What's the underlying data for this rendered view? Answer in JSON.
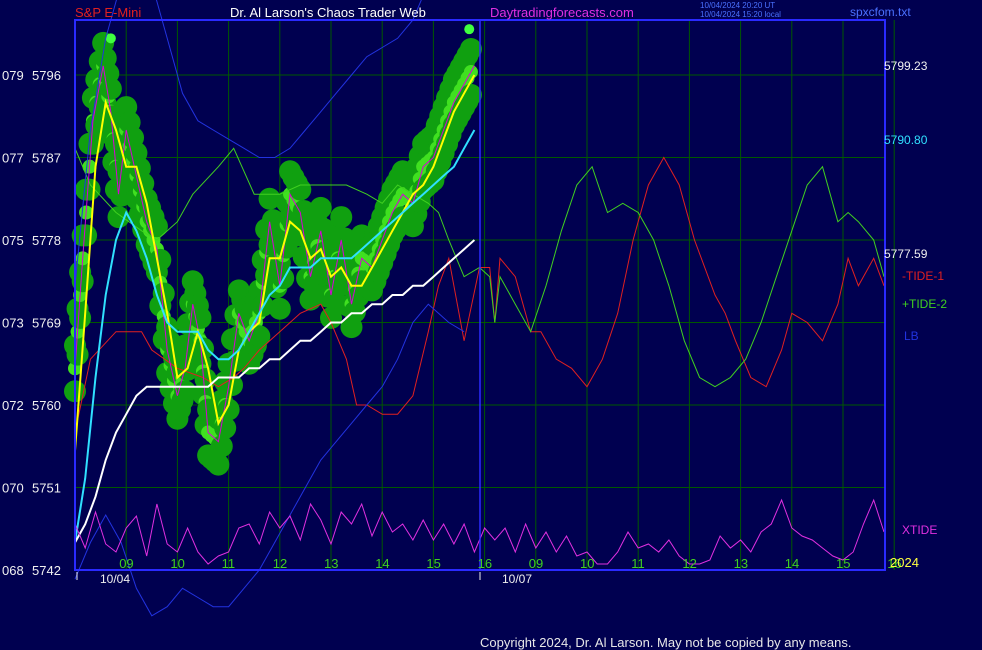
{
  "header": {
    "instrument": "S&P E-Mini",
    "site_title": "Dr. Al Larson's Chaos Trader Web",
    "url": "Daytradingforecasts.com",
    "timestamp_ut": "10/04/2024 20:20 UT",
    "timestamp_local": "10/04/2024 15:20 local",
    "file": "spxcfom.txt"
  },
  "footer": {
    "copyright": "Copyright 2024, Dr. Al Larson. May not be copied by any means."
  },
  "colors": {
    "background": "#000050",
    "frame": "#2a2aff",
    "grid": "#005800",
    "price": "#f0f0f0"
  },
  "chart_data": {
    "type": "line",
    "title": "S&P E-Mini",
    "ylim": [
      5742,
      5802
    ],
    "grid": true,
    "y_ticks": [
      {
        "left": "068",
        "price": "5742"
      },
      {
        "left": "070",
        "price": "5751"
      },
      {
        "left": "072",
        "price": "5760"
      },
      {
        "left": "073",
        "price": "5769"
      },
      {
        "left": "075",
        "price": "5778"
      },
      {
        "left": "077",
        "price": "5787"
      },
      {
        "left": "079",
        "price": "5796"
      }
    ],
    "x_hour_labels": [
      "09",
      "10",
      "11",
      "12",
      "13",
      "14",
      "15",
      "16",
      "09",
      "10",
      "11",
      "12",
      "13",
      "14",
      "15",
      "16"
    ],
    "date_labels": [
      "10/04",
      "10/07"
    ],
    "year_label": "2024",
    "right_labels": {
      "top_band": "5799.23",
      "middle_band": "5790.80",
      "close": "5777.59",
      "tide1": "-TIDE-1",
      "tide2": "+TIDE-2",
      "lb": "LB",
      "xtide": "XTIDE"
    },
    "series": [
      {
        "name": "-TIDE-1",
        "color": "#e02020",
        "x": [
          0,
          0.3,
          0.8,
          1.3,
          1.5,
          2.0,
          2.5,
          2.8,
          3.1,
          3.3,
          3.6,
          4.0,
          4.4,
          4.8,
          5.0,
          5.3,
          5.5,
          5.7,
          6.0,
          6.3,
          6.6,
          6.9,
          7.1,
          7.3,
          7.6,
          7.9,
          8.1,
          8.2,
          8.3,
          8.6,
          8.9,
          9.1,
          9.4,
          9.7,
          10.0,
          10.3,
          10.6,
          10.9,
          11.2,
          11.5,
          11.8,
          12.1,
          12.5,
          12.7,
          12.9,
          13.2,
          13.5,
          13.8,
          14.0,
          14.3,
          14.6,
          14.9,
          15.1,
          15.3,
          15.6,
          15.8
        ],
        "y": [
          5757,
          5765,
          5768,
          5768,
          5766,
          5764,
          5763,
          5762,
          5763,
          5764,
          5766,
          5768,
          5770,
          5771,
          5769,
          5765,
          5760,
          5760,
          5759,
          5759,
          5761,
          5768,
          5773,
          5776,
          5767,
          5775,
          5775,
          5769,
          5776,
          5774,
          5768,
          5768,
          5765,
          5764,
          5762,
          5765,
          5770,
          5778,
          5784,
          5787,
          5784,
          5778,
          5772,
          5770,
          5767,
          5763,
          5762,
          5766,
          5770,
          5769,
          5767,
          5771,
          5776,
          5773,
          5776,
          5773
        ]
      },
      {
        "name": "+TIDE-2",
        "color": "#40d020",
        "x": [
          0,
          0.3,
          0.8,
          1.3,
          1.6,
          2.0,
          2.3,
          2.8,
          3.1,
          3.5,
          4.0,
          4.4,
          4.8,
          5.0,
          5.3,
          5.7,
          6.0,
          6.3,
          6.6,
          6.9,
          7.1,
          7.3,
          7.6,
          7.9,
          8.1,
          8.2,
          8.3,
          8.6,
          8.9,
          9.2,
          9.5,
          9.8,
          10.1,
          10.4,
          10.7,
          11.0,
          11.3,
          11.6,
          11.9,
          12.2,
          12.5,
          12.8,
          13.1,
          13.4,
          13.7,
          14.0,
          14.3,
          14.6,
          14.9,
          15.1,
          15.3,
          15.6,
          15.8
        ],
        "y": [
          5788,
          5784,
          5781,
          5779,
          5778,
          5780,
          5783,
          5786,
          5788,
          5783,
          5783,
          5784,
          5784,
          5784,
          5784,
          5783,
          5782,
          5784,
          5783,
          5782,
          5781,
          5778,
          5774,
          5775,
          5774,
          5769,
          5774,
          5771,
          5768,
          5773,
          5779,
          5784,
          5786,
          5781,
          5782,
          5781,
          5778,
          5773,
          5767,
          5763,
          5762,
          5763,
          5765,
          5769,
          5774,
          5779,
          5784,
          5786,
          5780,
          5781,
          5780,
          5778,
          5774
        ]
      },
      {
        "name": "LB",
        "color": "#2233e0",
        "note": "upper band",
        "x": [
          0,
          0.3,
          0.6,
          0.9,
          1.2,
          1.5,
          1.8,
          2.1,
          2.4,
          2.7,
          3.0,
          3.3,
          3.6,
          3.9,
          4.2,
          4.5,
          4.8,
          5.1,
          5.4,
          5.7,
          6.0,
          6.3,
          6.6,
          6.9,
          7.1,
          7.3,
          7.6
        ],
        "y": [
          5773,
          5790,
          5800,
          5806,
          5808,
          5806,
          5800,
          5794,
          5791,
          5790,
          5789,
          5788,
          5787,
          5787,
          5788,
          5790,
          5792,
          5794,
          5796,
          5798,
          5799,
          5800,
          5802,
          5806,
          5810,
          5813,
          5814
        ]
      },
      {
        "name": "LB lower",
        "color": "#2233e0",
        "x": [
          0,
          0.3,
          0.6,
          0.9,
          1.2,
          1.5,
          1.8,
          2.1,
          2.4,
          2.7,
          3.0,
          3.3,
          3.6,
          3.9,
          4.2,
          4.5,
          4.8,
          5.1,
          5.4,
          5.7,
          6.0,
          6.3,
          6.6,
          6.9,
          7.1,
          7.3,
          7.6
        ],
        "y": [
          5741,
          5745,
          5748,
          5745,
          5740,
          5737,
          5738,
          5740,
          5739,
          5738,
          5738,
          5740,
          5742,
          5745,
          5748,
          5751,
          5754,
          5756,
          5758,
          5760,
          5762,
          5765,
          5769,
          5771,
          5770,
          5769,
          5768
        ]
      },
      {
        "name": "price",
        "color": "#d800d8",
        "x": [
          0,
          0.15,
          0.35,
          0.55,
          0.7,
          0.85,
          1.0,
          1.2,
          1.4,
          1.6,
          1.8,
          2.0,
          2.15,
          2.3,
          2.45,
          2.6,
          2.8,
          3.0,
          3.2,
          3.4,
          3.6,
          3.8,
          4.0,
          4.2,
          4.4,
          4.6,
          4.8,
          5.0,
          5.2,
          5.4,
          5.6,
          5.8,
          6.0,
          6.2,
          6.4,
          6.6,
          6.8,
          7.0,
          7.2,
          7.4,
          7.6,
          7.8
        ],
        "y": [
          5764,
          5776,
          5791,
          5797,
          5792,
          5783,
          5790,
          5785,
          5780,
          5777,
          5766,
          5761,
          5764,
          5771,
          5767,
          5757,
          5756,
          5762,
          5770,
          5767,
          5770,
          5780,
          5773,
          5783,
          5781,
          5774,
          5779,
          5772,
          5778,
          5771,
          5776,
          5775,
          5778,
          5781,
          5783,
          5782,
          5786,
          5787,
          5790,
          5793,
          5795,
          5797
        ]
      },
      {
        "name": "fast avg",
        "color": "#ffff00",
        "x": [
          0,
          0.2,
          0.4,
          0.6,
          0.8,
          1.0,
          1.2,
          1.4,
          1.6,
          1.8,
          2.0,
          2.2,
          2.4,
          2.6,
          2.8,
          3.0,
          3.2,
          3.4,
          3.6,
          3.8,
          4.0,
          4.2,
          4.4,
          4.6,
          4.8,
          5.0,
          5.2,
          5.4,
          5.6,
          5.8,
          6.0,
          6.2,
          6.4,
          6.6,
          6.8,
          7.0,
          7.2,
          7.4,
          7.6,
          7.8
        ],
        "y": [
          5755,
          5770,
          5786,
          5793,
          5790,
          5786,
          5786,
          5782,
          5776,
          5770,
          5763,
          5764,
          5768,
          5764,
          5758,
          5760,
          5766,
          5768,
          5769,
          5776,
          5776,
          5780,
          5779,
          5776,
          5777,
          5774,
          5775,
          5773,
          5773,
          5775,
          5777,
          5779,
          5781,
          5783,
          5784,
          5786,
          5789,
          5792,
          5794,
          5796
        ]
      },
      {
        "name": "medium avg",
        "color": "#30e0ff",
        "x": [
          0,
          0.2,
          0.4,
          0.6,
          0.8,
          1.0,
          1.2,
          1.4,
          1.6,
          1.8,
          2.0,
          2.2,
          2.4,
          2.6,
          2.8,
          3.0,
          3.2,
          3.4,
          3.6,
          3.8,
          4.0,
          4.2,
          4.4,
          4.6,
          4.8,
          5.0,
          5.2,
          5.4,
          5.6,
          5.8,
          6.0,
          6.2,
          6.4,
          6.6,
          6.8,
          7.0,
          7.2,
          7.4,
          7.6,
          7.8
        ],
        "y": [
          5745,
          5752,
          5763,
          5772,
          5778,
          5781,
          5779,
          5776,
          5772,
          5769,
          5768,
          5768,
          5768,
          5766,
          5765,
          5765,
          5766,
          5768,
          5770,
          5772,
          5773,
          5775,
          5775,
          5775,
          5776,
          5776,
          5776,
          5776,
          5777,
          5778,
          5779,
          5780,
          5781,
          5782,
          5783,
          5784,
          5785,
          5786,
          5788,
          5790
        ]
      },
      {
        "name": "slow avg",
        "color": "#ffffff",
        "x": [
          0,
          0.2,
          0.4,
          0.6,
          0.8,
          1.0,
          1.2,
          1.4,
          1.6,
          1.8,
          2.0,
          2.2,
          2.4,
          2.6,
          2.8,
          3.0,
          3.2,
          3.4,
          3.6,
          3.8,
          4.0,
          4.2,
          4.4,
          4.6,
          4.8,
          5.0,
          5.2,
          5.4,
          5.6,
          5.8,
          6.0,
          6.2,
          6.4,
          6.6,
          6.8,
          7.0,
          7.2,
          7.4,
          7.6,
          7.8
        ],
        "y": [
          5745,
          5747,
          5750,
          5754,
          5757,
          5759,
          5761,
          5762,
          5762,
          5762,
          5762,
          5762,
          5762,
          5762,
          5763,
          5763,
          5763,
          5764,
          5764,
          5765,
          5765,
          5766,
          5767,
          5767,
          5768,
          5769,
          5769,
          5770,
          5770,
          5771,
          5771,
          5772,
          5772,
          5773,
          5773,
          5774,
          5775,
          5776,
          5777,
          5778
        ]
      },
      {
        "name": "XTIDE",
        "color": "#e030e0",
        "x": [
          0,
          0.2,
          0.4,
          0.6,
          0.8,
          1.0,
          1.2,
          1.4,
          1.6,
          1.8,
          2.0,
          2.2,
          2.4,
          2.6,
          2.8,
          3.0,
          3.2,
          3.4,
          3.6,
          3.8,
          4.0,
          4.2,
          4.4,
          4.6,
          4.8,
          5.0,
          5.2,
          5.4,
          5.6,
          5.8,
          6.0,
          6.2,
          6.4,
          6.6,
          6.8,
          7.0,
          7.2,
          7.4,
          7.6,
          7.8,
          8.0,
          8.2,
          8.4,
          8.6,
          8.8,
          9.0,
          9.2,
          9.4,
          9.6,
          9.8,
          10.0,
          10.2,
          10.4,
          10.6,
          10.8,
          11.0,
          11.2,
          11.4,
          11.6,
          11.8,
          12.0,
          12.2,
          12.4,
          12.6,
          12.8,
          13.0,
          13.2,
          13.4,
          13.6,
          13.8,
          14.0,
          14.2,
          14.4,
          14.6,
          14.8,
          15.0,
          15.2,
          15.4,
          15.6,
          15.8
        ],
        "y": [
          0.55,
          0.25,
          0.7,
          0.3,
          0.2,
          0.5,
          0.65,
          0.15,
          0.8,
          0.3,
          0.2,
          0.5,
          0.2,
          0.05,
          0.15,
          0.2,
          0.5,
          0.55,
          0.3,
          0.7,
          0.5,
          0.65,
          0.35,
          0.8,
          0.6,
          0.3,
          0.7,
          0.55,
          0.8,
          0.4,
          0.7,
          0.45,
          0.55,
          0.35,
          0.6,
          0.35,
          0.55,
          0.3,
          0.55,
          0.2,
          0.5,
          0.35,
          0.5,
          0.2,
          0.55,
          0.25,
          0.45,
          0.2,
          0.4,
          0.15,
          0.2,
          0.05,
          0.05,
          0.2,
          0.45,
          0.25,
          0.3,
          0.2,
          0.35,
          0.15,
          0.05,
          0.05,
          0.1,
          0.4,
          0.25,
          0.35,
          0.2,
          0.45,
          0.55,
          0.85,
          0.5,
          0.4,
          0.35,
          0.25,
          0.15,
          0.1,
          0.2,
          0.55,
          0.85,
          0.45
        ]
      }
    ]
  }
}
